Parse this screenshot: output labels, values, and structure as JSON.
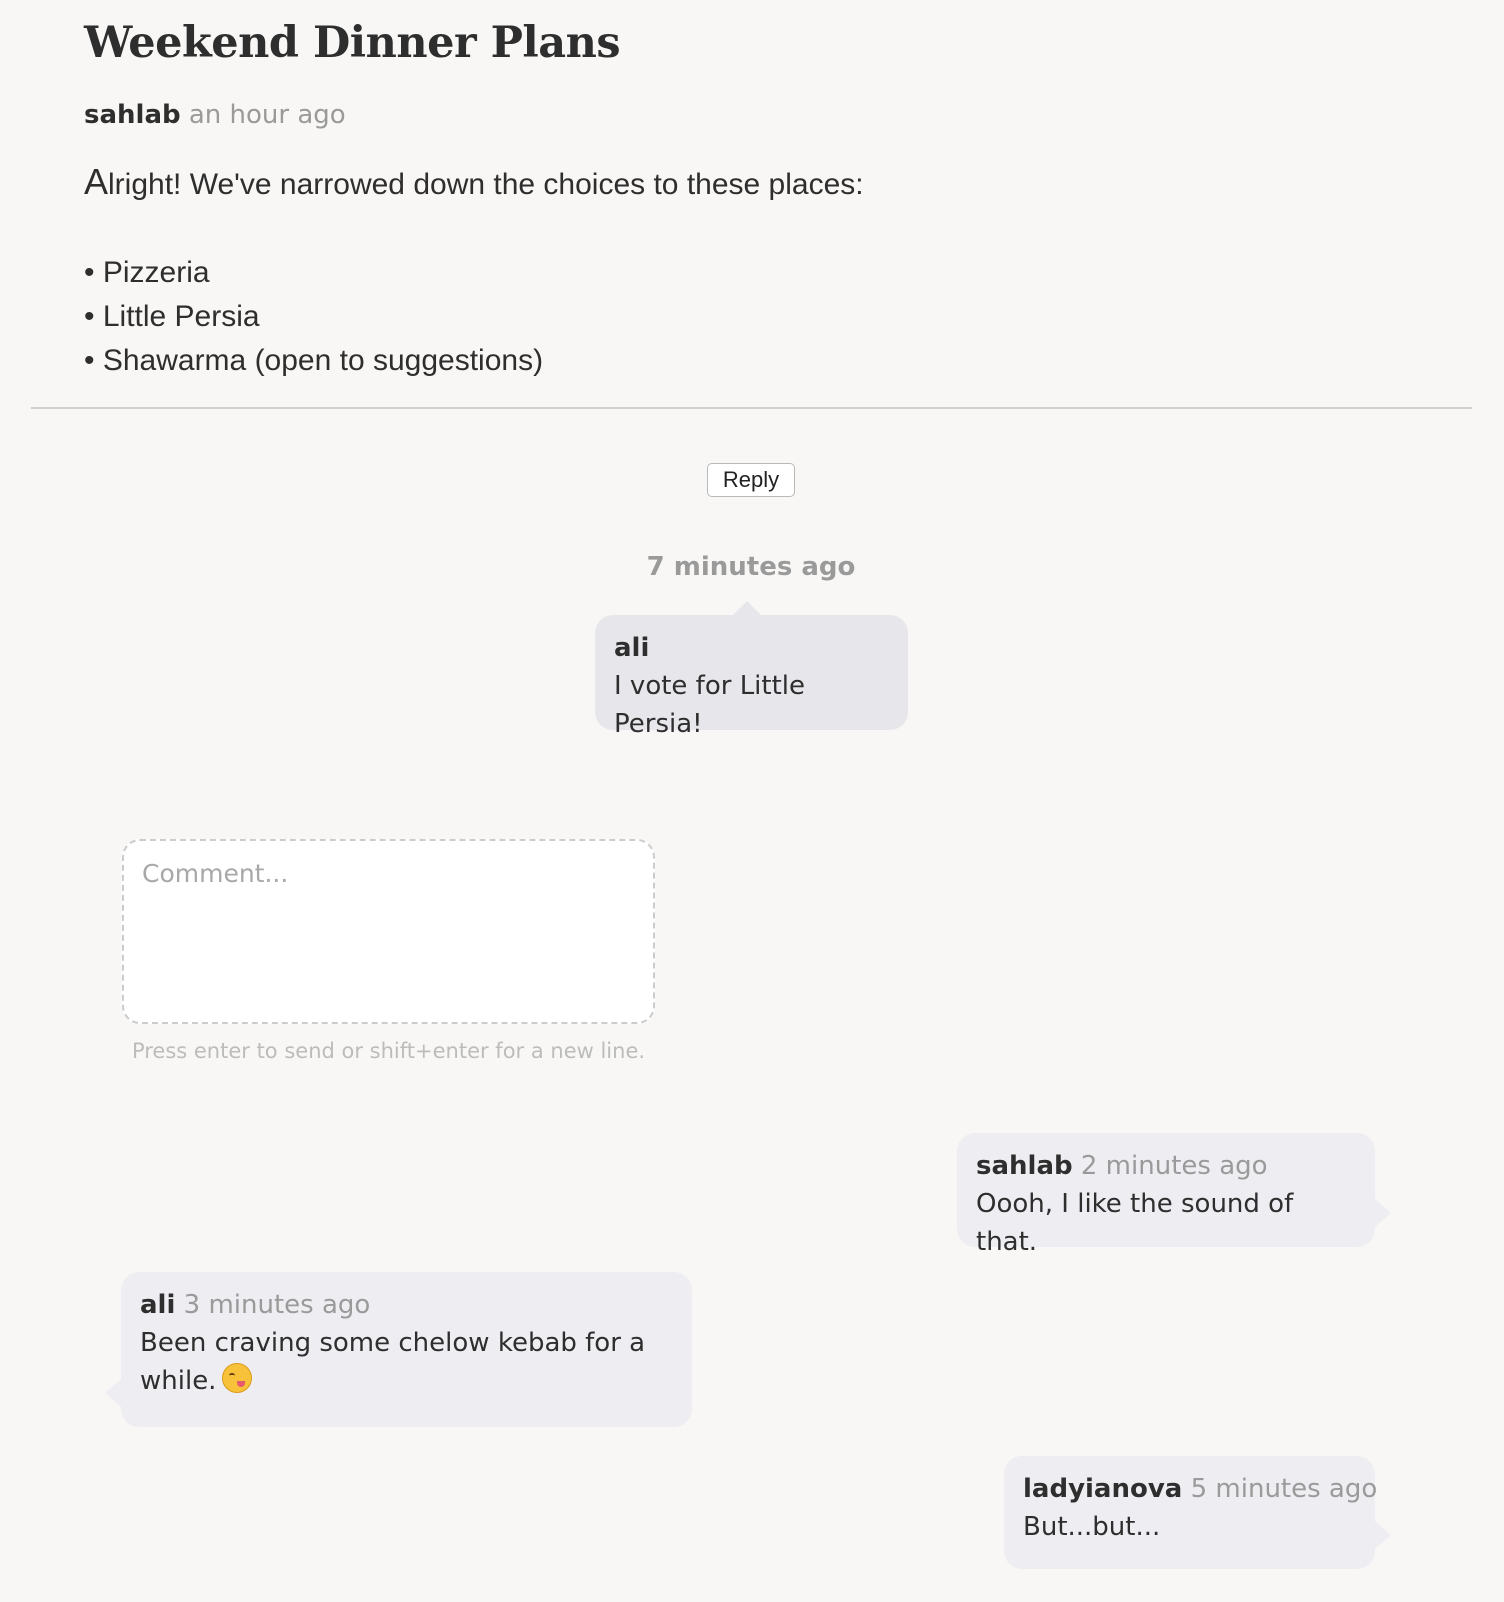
{
  "post": {
    "title": "Weekend Dinner Plans",
    "author": "sahlab",
    "time": "an hour ago",
    "intro_first_letter": "A",
    "intro_rest": "lright! We've narrowed down the choices to these places:",
    "choices": [
      "• Pizzeria",
      "• Little Persia",
      "• Shawarma (open to suggestions)"
    ]
  },
  "reply_label": "Reply",
  "thread": {
    "time": "7 minutes ago",
    "author": "ali",
    "text": "I vote for Little Persia!"
  },
  "composer": {
    "placeholder": "Comment...",
    "hint": "Press enter to send or shift+enter for a new line."
  },
  "comments": [
    {
      "author": "sahlab",
      "time": "2 minutes ago",
      "text": "Oooh, I like the sound of that."
    },
    {
      "author": "ali",
      "time": "3 minutes ago",
      "text": "Been craving some chelow kebab for a while.",
      "emoji": "drooling-face-emoji"
    },
    {
      "author": "ladyianova",
      "time": "5 minutes ago",
      "text": "But...but..."
    }
  ]
}
